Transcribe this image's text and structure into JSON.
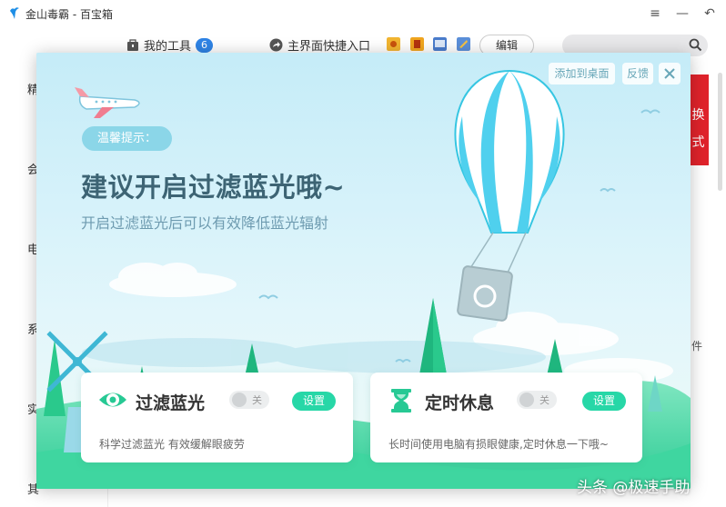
{
  "window": {
    "title": "金山毒霸 - 百宝箱",
    "controls": [
      "≡",
      "—",
      "↶"
    ]
  },
  "toolbar": {
    "my_tools_label": "我的工具",
    "my_tools_count": "6",
    "shortcut_label": "主界面快捷入口",
    "edit_label": "编辑",
    "search_placeholder": ""
  },
  "background": {
    "left_items": [
      "精",
      "会",
      "电",
      "系",
      "实",
      "其"
    ],
    "right_red_text": [
      "换",
      "式"
    ],
    "right_text": "件"
  },
  "modal": {
    "add_to_desktop": "添加到桌面",
    "feedback": "反馈",
    "tip_label": "温馨提示：",
    "headline": "建议开启过滤蓝光哦~",
    "subline": "开启过滤蓝光后可以有效降低蓝光辐射",
    "cards": [
      {
        "title": "过滤蓝光",
        "toggle_label": "关",
        "button_label": "设置",
        "description": "科学过滤蓝光 有效缓解眼疲劳",
        "icon": "eye-icon"
      },
      {
        "title": "定时休息",
        "toggle_label": "关",
        "button_label": "设置",
        "description": "长时间使用电脑有损眼健康,定时休息一下哦~",
        "icon": "hourglass-icon"
      }
    ]
  },
  "watermark": "头条 @极速手助",
  "colors": {
    "accent_green": "#27d7a7",
    "badge_blue": "#2f84e6",
    "headline": "#3d6474",
    "red_banner": "#e0232b"
  }
}
